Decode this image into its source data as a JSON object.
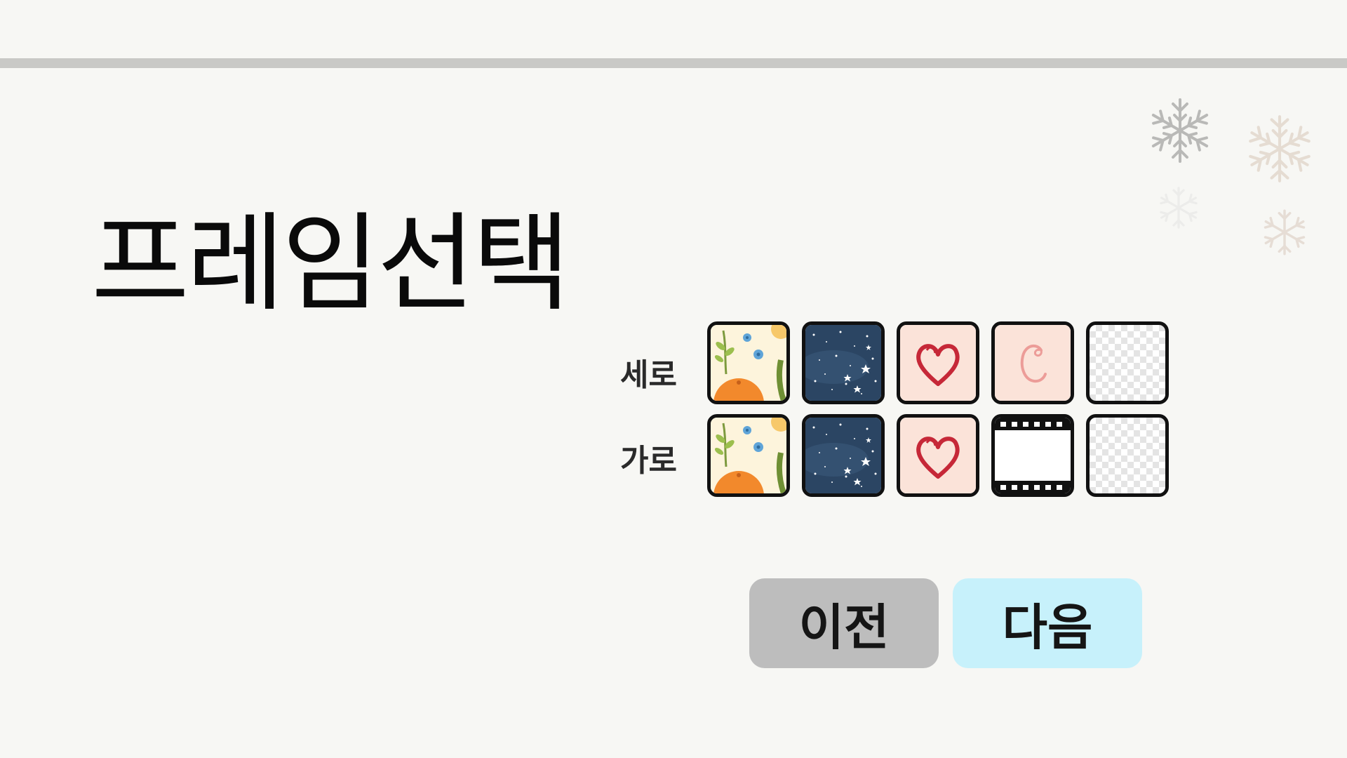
{
  "page": {
    "title": "프레임선택"
  },
  "frames": {
    "rows": [
      {
        "label": "세로",
        "options": [
          "citrus-pattern",
          "starry-night",
          "heart",
          "cursive-c",
          "transparent"
        ]
      },
      {
        "label": "가로",
        "options": [
          "citrus-pattern",
          "starry-night",
          "heart",
          "film-strip",
          "transparent"
        ]
      }
    ]
  },
  "buttons": {
    "prev_label": "이전",
    "next_label": "다음"
  },
  "colors": {
    "background": "#f7f7f4",
    "top_bar": "#c9c9c6",
    "prev_button": "#bdbdbd",
    "next_button": "#c7f1fb",
    "tile_border": "#111111",
    "heart": "#c62838",
    "pink_tile": "#fbe3d9",
    "night_sky": "#2b4563"
  },
  "icons": {
    "decorations": [
      "snowflake-icon",
      "snowflake-icon",
      "snowflake-icon",
      "snowflake-icon"
    ]
  }
}
